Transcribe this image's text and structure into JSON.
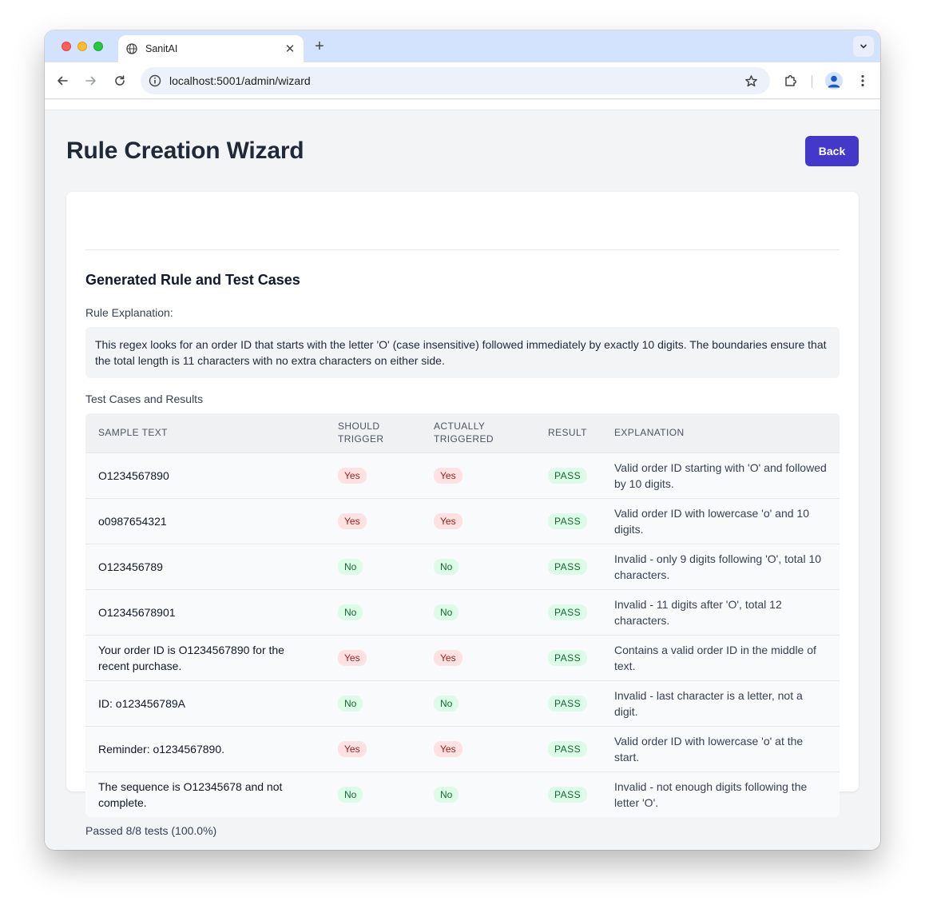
{
  "browser": {
    "tab_title": "SanitAI",
    "url": "localhost:5001/admin/wizard"
  },
  "header": {
    "title": "Rule Creation Wizard",
    "back_label": "Back"
  },
  "content": {
    "section_title": "Generated Rule and Test Cases",
    "explanation_label": "Rule Explanation:",
    "explanation_text": "This regex looks for an order ID that starts with the letter 'O' (case insensitive) followed immediately by exactly 10 digits. The boundaries ensure that the total length is 11 characters with no extra characters on either side.",
    "tests_label": "Test Cases and Results",
    "summary": "Passed 8/8 tests (100.0%)"
  },
  "table": {
    "headers": [
      "SAMPLE TEXT",
      "SHOULD TRIGGER",
      "ACTUALLY TRIGGERED",
      "RESULT",
      "EXPLANATION"
    ],
    "rows": [
      {
        "sample": "O1234567890",
        "should": "Yes",
        "actual": "Yes",
        "result": "PASS",
        "explanation": "Valid order ID starting with 'O' and followed by 10 digits."
      },
      {
        "sample": "o0987654321",
        "should": "Yes",
        "actual": "Yes",
        "result": "PASS",
        "explanation": "Valid order ID with lowercase 'o' and 10 digits."
      },
      {
        "sample": "O123456789",
        "should": "No",
        "actual": "No",
        "result": "PASS",
        "explanation": "Invalid - only 9 digits following 'O', total 10 characters."
      },
      {
        "sample": "O12345678901",
        "should": "No",
        "actual": "No",
        "result": "PASS",
        "explanation": "Invalid - 11 digits after 'O', total 12 characters."
      },
      {
        "sample": "Your order ID is O1234567890 for the recent purchase.",
        "should": "Yes",
        "actual": "Yes",
        "result": "PASS",
        "explanation": "Contains a valid order ID in the middle of text."
      },
      {
        "sample": "ID: o123456789A",
        "should": "No",
        "actual": "No",
        "result": "PASS",
        "explanation": "Invalid - last character is a letter, not a digit."
      },
      {
        "sample": "Reminder: o1234567890.",
        "should": "Yes",
        "actual": "Yes",
        "result": "PASS",
        "explanation": "Valid order ID with lowercase 'o' at the start."
      },
      {
        "sample": "The sequence is O12345678 and not complete.",
        "should": "No",
        "actual": "No",
        "result": "PASS",
        "explanation": "Invalid - not enough digits following the letter 'O'."
      }
    ]
  }
}
